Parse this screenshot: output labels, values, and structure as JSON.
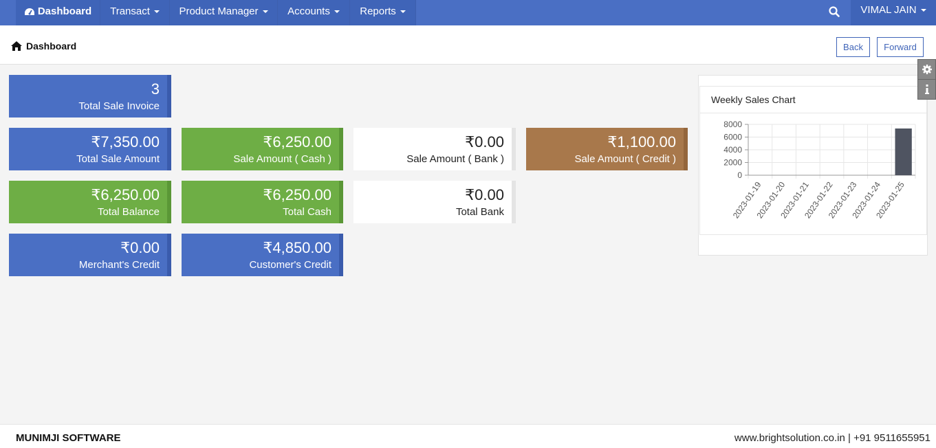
{
  "navbar": {
    "items": [
      {
        "label": "Dashboard",
        "has_caret": false
      },
      {
        "label": "Transact",
        "has_caret": true
      },
      {
        "label": "Product Manager",
        "has_caret": true
      },
      {
        "label": "Accounts",
        "has_caret": true
      },
      {
        "label": "Reports",
        "has_caret": true
      }
    ],
    "user": "VIMAL JAIN",
    "search_icon": "search-icon",
    "accent": "#4a6fc4"
  },
  "header": {
    "breadcrumb": "Dashboard",
    "back_label": "Back",
    "forward_label": "Forward"
  },
  "cards": {
    "total_sale_invoice": {
      "value": "3",
      "label": "Total Sale Invoice"
    },
    "total_sale_amount": {
      "value": "₹7,350.00",
      "label": "Total Sale Amount"
    },
    "sale_amount_cash": {
      "value": "₹6,250.00",
      "label": "Sale Amount ( Cash )"
    },
    "sale_amount_bank": {
      "value": "₹0.00",
      "label": "Sale Amount ( Bank )"
    },
    "sale_amount_credit": {
      "value": "₹1,100.00",
      "label": "Sale Amount ( Credit )"
    },
    "total_balance": {
      "value": "₹6,250.00",
      "label": "Total Balance"
    },
    "total_cash": {
      "value": "₹6,250.00",
      "label": "Total Cash"
    },
    "total_bank": {
      "value": "₹0.00",
      "label": "Total Bank"
    },
    "merchants_credit": {
      "value": "₹0.00",
      "label": "Merchant's Credit"
    },
    "customers_credit": {
      "value": "₹4,850.00",
      "label": "Customer's Credit"
    }
  },
  "chart_data": {
    "type": "bar",
    "title": "Weekly Sales Chart",
    "categories": [
      "2023-01-19",
      "2023-01-20",
      "2023-01-21",
      "2023-01-22",
      "2023-01-23",
      "2023-01-24",
      "2023-01-25"
    ],
    "values": [
      0,
      0,
      0,
      0,
      0,
      0,
      7350
    ],
    "yticks": [
      "8000",
      "6000",
      "4000",
      "2000",
      "0"
    ],
    "ylim": [
      0,
      8000
    ],
    "bar_color": "#4f5461",
    "grid": true
  },
  "footer": {
    "brand": "MUNIMJI SOFTWARE",
    "contact": "www.brightsolution.co.in | +91 9511655951"
  }
}
